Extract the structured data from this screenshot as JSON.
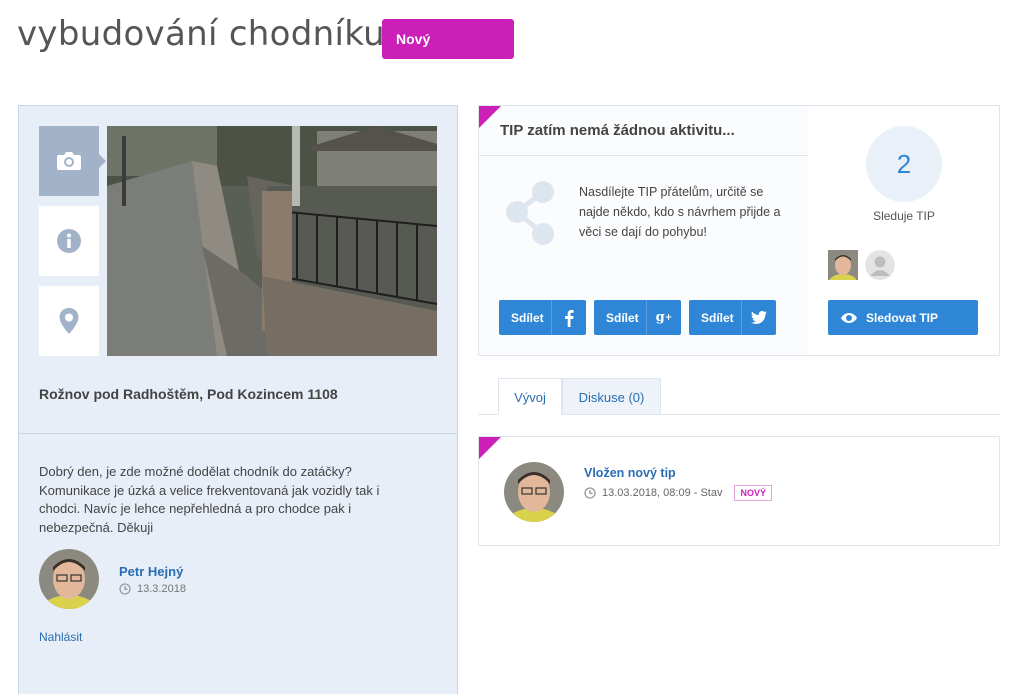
{
  "page": {
    "title": "vybudování chodníku",
    "status_badge": "Nový"
  },
  "tip": {
    "address": "Rožnov pod Radhoštěm, Pod Kozincem 1108",
    "description": "Dobrý den, je zde možné dodělat chodník do zatáčky? Komunikace je úzká a velice frekventovaná jak vozidly tak i chodci. Navíc je lehce nepřehledná a pro chodce pak i nebezpečná. Děkuji",
    "author": {
      "name": "Petr Hejný",
      "date": "13.3.2018"
    },
    "report_label": "Nahlásit",
    "thumbnails": [
      {
        "icon": "camera-icon"
      },
      {
        "icon": "info-icon"
      },
      {
        "icon": "location-pin-icon"
      }
    ]
  },
  "activity": {
    "title": "TIP zatím nemá žádnou aktivitu...",
    "share_text": "Nasdílejte TIP přátelům, určitě se najde někdo, kdo s návrhem přijde a věci se dají do pohybu!",
    "share_buttons": [
      {
        "label": "Sdílet",
        "icon": "facebook-icon"
      },
      {
        "label": "Sdílet",
        "icon": "google-plus-icon"
      },
      {
        "label": "Sdílet",
        "icon": "twitter-icon"
      }
    ]
  },
  "follow": {
    "count": "2",
    "label": "Sleduje TIP",
    "button_label": "Sledovat TIP"
  },
  "tabs": [
    {
      "label": "Vývoj",
      "active": true
    },
    {
      "label": "Diskuse (0)",
      "active": false
    }
  ],
  "timeline": [
    {
      "title": "Vložen nový tip",
      "meta": "13.03.2018, 08:09 - Stav",
      "badge": "NOVÝ"
    }
  ],
  "colors": {
    "accent": "#cc1fb8",
    "primary": "#2f86d6",
    "link": "#2a6db3",
    "panel": "#e7eef7"
  }
}
